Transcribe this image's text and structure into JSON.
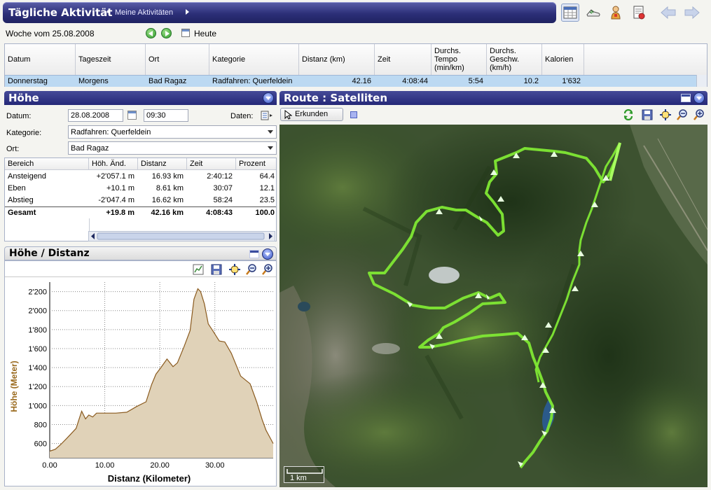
{
  "header": {
    "title": "Tägliche Aktivität",
    "bullet": "•",
    "subtitle": "Meine Aktivitäten"
  },
  "toolbar": {
    "icons": [
      "calendar-view-icon",
      "shoe-icon",
      "athlete-icon",
      "report-icon",
      "back-arrow-icon",
      "forward-arrow-icon"
    ]
  },
  "week": {
    "label": "Woche vom 25.08.2008",
    "today_label": "Heute"
  },
  "activity_grid": {
    "columns": [
      "Datum",
      "Tageszeit",
      "Ort",
      "Kategorie",
      "Distanz (km)",
      "Zeit",
      "Durchs. Tempo (min/km)",
      "Durchs. Geschw. (km/h)",
      "Kalorien"
    ],
    "column_lines": [
      [
        "Datum"
      ],
      [
        "Tageszeit"
      ],
      [
        "Ort"
      ],
      [
        "Kategorie"
      ],
      [
        "Distanz (km)"
      ],
      [
        "Zeit"
      ],
      [
        "Durchs.",
        "Tempo",
        "(min/km)"
      ],
      [
        "Durchs.",
        "Geschw.",
        "(km/h)"
      ],
      [
        "Kalorien"
      ]
    ],
    "row": {
      "datum": "Donnerstag",
      "tageszeit": "Morgens",
      "ort": "Bad Ragaz",
      "kategorie": "Radfahren: Querfeldein",
      "distanz": "42.16",
      "zeit": "4:08:44",
      "tempo": "5:54",
      "geschw": "10.2",
      "kalorien": "1'632"
    }
  },
  "hoehe_panel": {
    "title": "Höhe",
    "datum_label": "Datum:",
    "datum_value": "28.08.2008",
    "zeit_value": "09:30",
    "daten_label": "Daten:",
    "kategorie_label": "Kategorie:",
    "kategorie_value": "Radfahren: Querfeldein",
    "ort_label": "Ort:",
    "ort_value": "Bad Ragaz",
    "table": {
      "headers": [
        "Bereich",
        "Höh. Änd.",
        "Distanz",
        "Zeit",
        "Prozent"
      ],
      "rows": [
        {
          "bereich": "Ansteigend",
          "aend": "+2'057.1 m",
          "distanz": "16.93 km",
          "zeit": "2:40:12",
          "prozent": "64.4"
        },
        {
          "bereich": "Eben",
          "aend": "+10.1 m",
          "distanz": "8.61 km",
          "zeit": "30:07",
          "prozent": "12.1"
        },
        {
          "bereich": "Abstieg",
          "aend": "-2'047.4 m",
          "distanz": "16.62 km",
          "zeit": "58:24",
          "prozent": "23.5"
        },
        {
          "bereich": "Gesamt",
          "aend": "+19.8 m",
          "distanz": "42.16 km",
          "zeit": "4:08:43",
          "prozent": "100.0"
        }
      ]
    }
  },
  "chart_panel": {
    "title": "Höhe / Distanz"
  },
  "chart_data": {
    "type": "area",
    "title": "",
    "xlabel": "Distanz (Kilometer)",
    "ylabel": "Höhe (Meter)",
    "xlim": [
      0,
      40.6
    ],
    "ylim": [
      450,
      2300
    ],
    "xticks": [
      0,
      10,
      20,
      30
    ],
    "xtick_labels": [
      "0.00",
      "10.00",
      "20.00",
      "30.00"
    ],
    "yticks": [
      600,
      800,
      1000,
      1200,
      1400,
      1600,
      1800,
      2000,
      2200
    ],
    "ytick_labels": [
      "600",
      "800",
      "1'000",
      "1'200",
      "1'400",
      "1'600",
      "1'800",
      "2'000",
      "2'200"
    ],
    "fill_color": "#e0d2b8",
    "line_color": "#8a5a1e",
    "x": [
      0,
      1,
      2,
      3,
      4,
      4.8,
      5.3,
      5.8,
      6.5,
      7.1,
      7.8,
      8.5,
      10,
      12,
      14,
      15.8,
      17.5,
      18.5,
      19.3,
      20.2,
      21.3,
      22.4,
      23.2,
      24.4,
      25.5,
      26.2,
      26.9,
      27.4,
      28.1,
      28.8,
      29.6,
      30.8,
      31.8,
      33,
      34.7,
      36.4,
      37.6,
      38.6,
      39.3,
      40.6
    ],
    "y": [
      520,
      540,
      590,
      650,
      710,
      760,
      850,
      940,
      860,
      900,
      880,
      920,
      920,
      920,
      930,
      990,
      1040,
      1220,
      1330,
      1400,
      1490,
      1410,
      1450,
      1620,
      1790,
      2120,
      2230,
      2200,
      2070,
      1860,
      1790,
      1680,
      1670,
      1550,
      1310,
      1230,
      1040,
      850,
      740,
      600
    ]
  },
  "route_panel": {
    "title": "Route : Satelliten",
    "explore_label": "Erkunden",
    "scale_label": "1 km",
    "route_color": "#7fe834"
  }
}
